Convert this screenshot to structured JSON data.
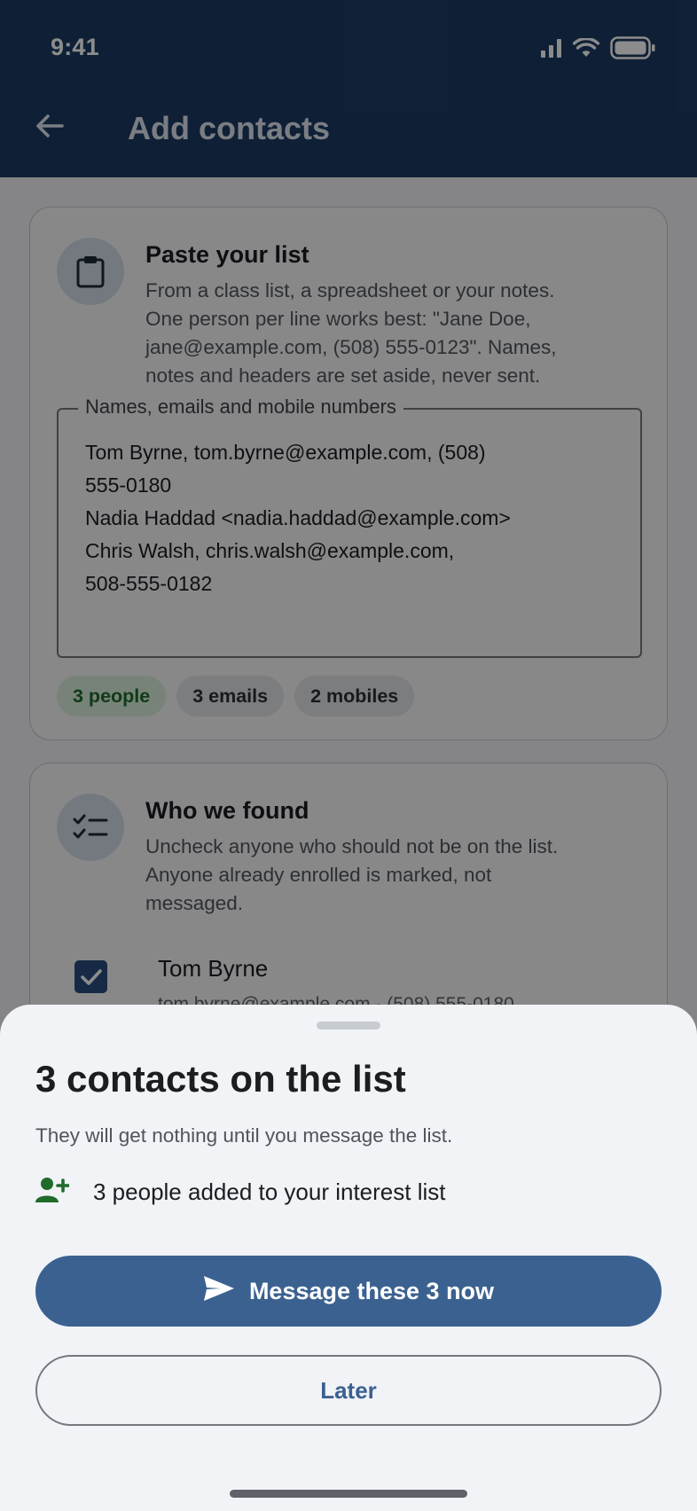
{
  "status_bar": {
    "time": "9:41",
    "icons": [
      "signal-icon",
      "wifi-icon",
      "battery-icon"
    ]
  },
  "app_bar": {
    "title": "Add contacts",
    "back_icon": "arrow-left-icon"
  },
  "paste_card": {
    "icon": "clipboard-icon",
    "title": "Paste your list",
    "description": "From a class list, a spreadsheet or your notes.\nOne person per line works best: \"Jane Doe,\njane@example.com, (508) 555-0123\". Names,\nnotes and headers are set aside, never sent.",
    "textarea": {
      "label": "Names, emails and mobile numbers",
      "value": "Tom Byrne, tom.byrne@example.com, (508)\n555-0180\nNadia Haddad <nadia.haddad@example.com>\nChris Walsh, chris.walsh@example.com,\n508-555-0182"
    },
    "chips": {
      "people": "3 people",
      "emails": "3 emails",
      "mobiles": "2 mobiles"
    }
  },
  "found_card": {
    "icon": "checklist-icon",
    "title": "Who we found",
    "description": "Uncheck anyone who should not be on the list.\nAnyone already enrolled is marked, not\nmessaged.",
    "people": [
      {
        "name": "Tom Byrne",
        "detail": "tom.byrne@example.com · (508) 555-0180",
        "checked": true
      }
    ]
  },
  "sheet": {
    "title": "3 contacts on the list",
    "subtitle": "They will get nothing until you message the list.",
    "result_icon": "person-add-icon",
    "result_text": "3 people added to your interest list",
    "primary_button": "Message these 3 now",
    "primary_icon": "send-icon",
    "secondary_button": "Later"
  },
  "colors": {
    "app_bar": "#1d3b63",
    "primary": "#3b6190",
    "success": "#1f6b2a",
    "sheet_bg": "#f1f3f7"
  }
}
